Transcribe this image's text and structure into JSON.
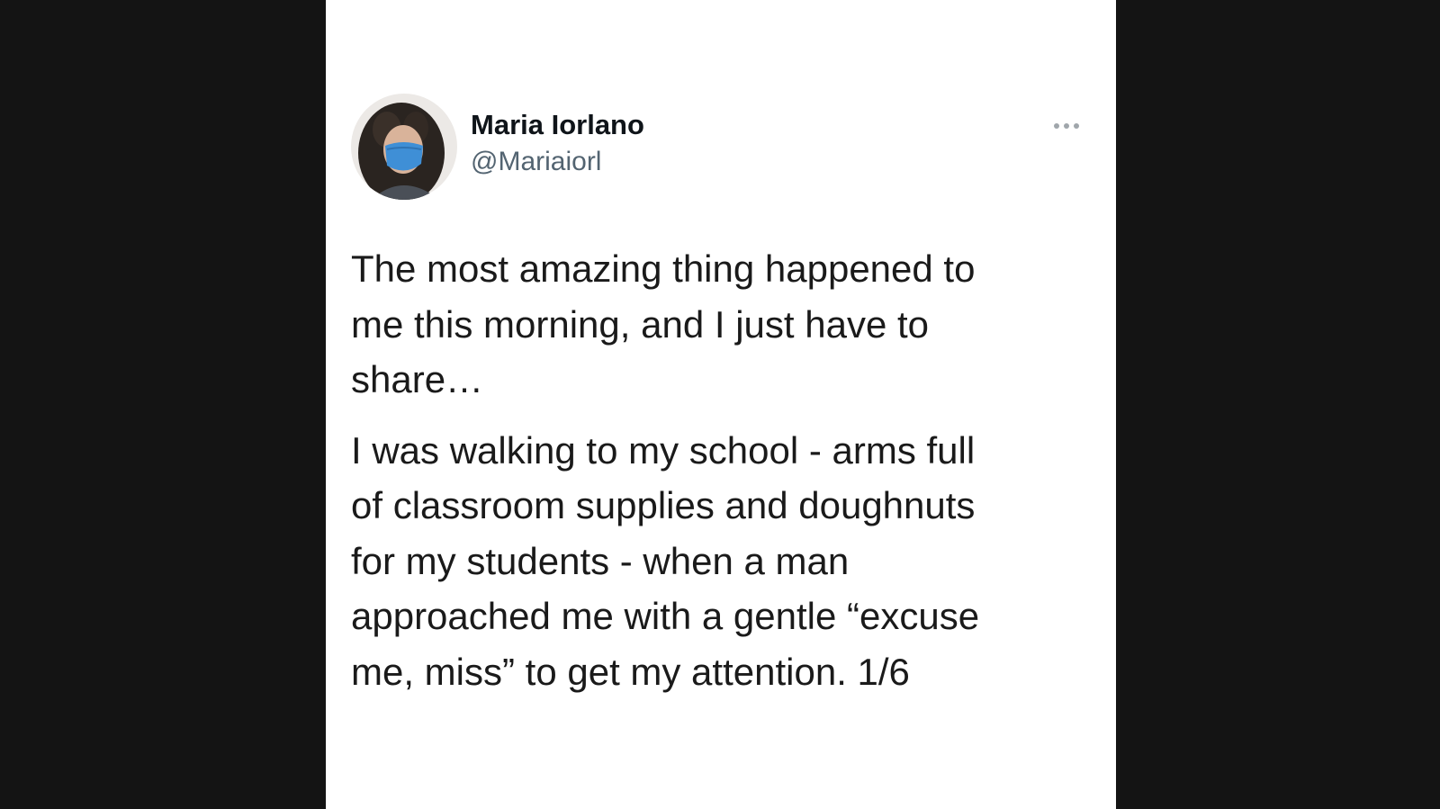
{
  "tweet": {
    "author": {
      "display_name": "Maria Iorlano",
      "handle": "@Mariaiorl",
      "avatar_icon": "profile-photo"
    },
    "more_icon": "ellipsis-icon",
    "paragraphs": [
      "The most amazing thing happened to\nme this morning, and I just have to\nshare…",
      "I was walking to my school - arms full\nof classroom supplies and doughnuts\nfor my students - when a man\napproached me with a gentle “excuse\nme, miss” to get my attention. 1/6"
    ]
  },
  "colors": {
    "background": "#141414",
    "card": "#ffffff",
    "name_text": "#0f1419",
    "handle_text": "#536471",
    "body_text": "#1a1a1a",
    "mask": "#3f8fd6"
  }
}
